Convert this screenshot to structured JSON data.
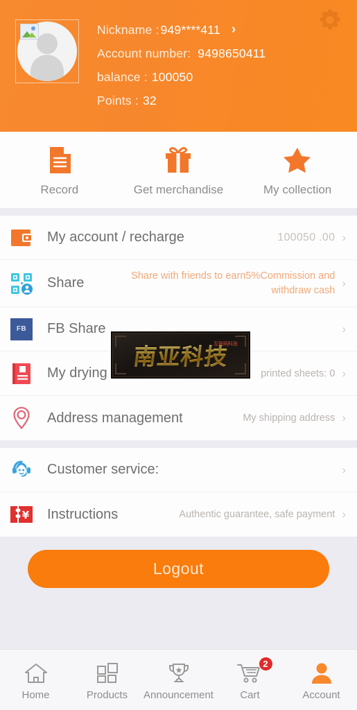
{
  "header": {
    "gear_icon": "gear-icon",
    "avatar_icon": "avatar-placeholder",
    "nickname_label": "Nickname :",
    "nickname_value": "949****411",
    "chevron": "›",
    "account_label": "Account number:",
    "account_value": "9498650411",
    "balance_label": "balance :",
    "balance_value": "100050",
    "points_label": "Points :",
    "points_value": "32",
    "bg_color": "#f7882c"
  },
  "quick_actions": [
    {
      "icon": "document-icon",
      "label": "Record"
    },
    {
      "icon": "gift-icon",
      "label": "Get merchandise"
    },
    {
      "icon": "star-icon",
      "label": "My collection"
    }
  ],
  "menu_groups": [
    {
      "rows": [
        {
          "icon": "wallet-icon",
          "title": "My account / recharge",
          "value": "100050 .00",
          "value_style": "big",
          "chevron": "›"
        },
        {
          "icon": "qrcode-share-icon",
          "title": "Share",
          "value": "Share with friends to earn5%Commission and withdraw cash",
          "value_style": "promo",
          "chevron": "›"
        },
        {
          "icon": "facebook-icon",
          "icon_text": "FB",
          "title": "FB Share",
          "value": "",
          "value_style": "plain",
          "chevron": "›"
        },
        {
          "icon": "list-book-icon",
          "title": "My drying list",
          "value": "printed sheets: 0",
          "value_style": "plain",
          "chevron": "›"
        },
        {
          "icon": "location-pin-icon",
          "title": "Address management",
          "value": "My shipping address",
          "value_style": "plain",
          "chevron": "›"
        }
      ]
    },
    {
      "rows": [
        {
          "icon": "headset-support-icon",
          "title": "Customer service:",
          "value": "",
          "value_style": "plain",
          "chevron": "›"
        },
        {
          "icon": "coupon-yen-icon",
          "title": "Instructions",
          "value": "Authentic guarantee, safe payment",
          "value_style": "plain",
          "chevron": "›"
        }
      ]
    }
  ],
  "logout": {
    "label": "Logout",
    "color": "#f97c0c"
  },
  "watermark": {
    "text": "南亚科技",
    "sub_text": "互联网科技"
  },
  "bottom_nav": [
    {
      "icon": "home-icon",
      "label": "Home",
      "active": false,
      "badge": ""
    },
    {
      "icon": "grid-products-icon",
      "label": "Products",
      "active": false,
      "badge": ""
    },
    {
      "icon": "trophy-icon",
      "label": "Announcement",
      "active": false,
      "badge": ""
    },
    {
      "icon": "cart-icon",
      "label": "Cart",
      "active": false,
      "badge": "2"
    },
    {
      "icon": "person-icon",
      "label": "Account",
      "active": true,
      "badge": ""
    }
  ],
  "colors": {
    "accent": "#f7882c",
    "badge": "#e02b2b",
    "background": "#ecebf1",
    "card": "#fdfdfd"
  }
}
